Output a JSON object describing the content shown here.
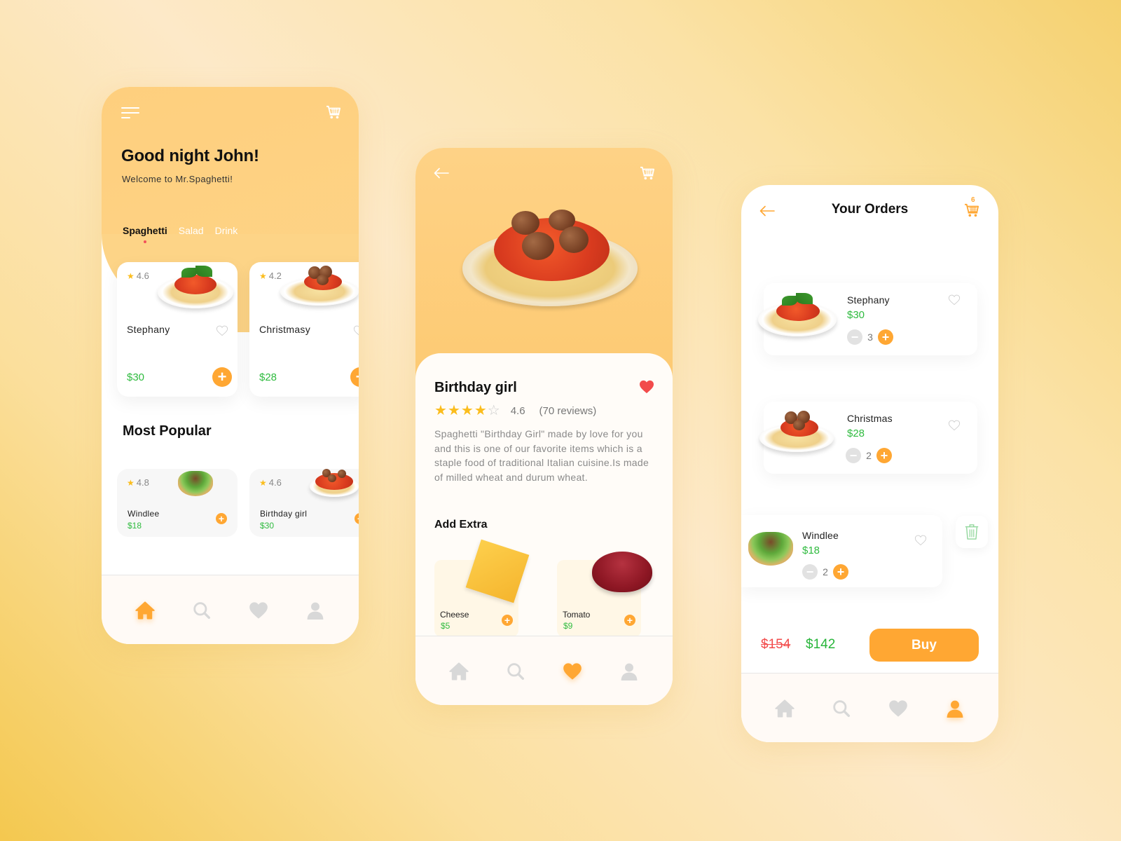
{
  "colors": {
    "accent": "#ffa733",
    "header": "#fdd487",
    "price_green": "#2fbb3f",
    "strike_red": "#f24b4b",
    "heart_red": "#f24b4b",
    "star": "#fbbd1d",
    "nav_inactive": "#d8d8d8"
  },
  "home": {
    "greeting": "Good night John!",
    "welcome": "Welcome to Mr.Spaghetti!",
    "icons": {
      "menu": "menu-icon",
      "cart": "cart-icon"
    },
    "categories": [
      {
        "label": "Spaghetti",
        "active": true
      },
      {
        "label": "Salad",
        "active": false
      },
      {
        "label": "Drink",
        "active": false
      }
    ],
    "featured": [
      {
        "name": "Stephany",
        "rating": "4.6",
        "price": "$30"
      },
      {
        "name": "Christmasy",
        "rating": "4.2",
        "price": "$28"
      }
    ],
    "popular_title": "Most Popular",
    "popular": [
      {
        "name": "Windlee",
        "rating": "4.8",
        "price": "$18"
      },
      {
        "name": "Birthday girl",
        "rating": "4.6",
        "price": "$30"
      }
    ],
    "nav": {
      "active": "home",
      "items": [
        "home",
        "search",
        "favorites",
        "profile"
      ]
    }
  },
  "detail": {
    "icons": {
      "back": "back-arrow-icon",
      "cart": "cart-icon"
    },
    "title": "Birthday girl",
    "favorited": true,
    "stars_filled": 4,
    "stars_total": 5,
    "rating": "4.6",
    "reviews": "(70 reviews)",
    "description": "Spaghetti \"Birthday Girl\" made by love for you and this is one of our favorite items which is a staple food of traditional Italian cuisine.Is made of milled wheat and durum wheat.",
    "extras_title": "Add Extra",
    "extras": [
      {
        "name": "Cheese",
        "price": "$5"
      },
      {
        "name": "Tomato",
        "price": "$9"
      }
    ],
    "nav": {
      "active": "favorites",
      "items": [
        "home",
        "search",
        "favorites",
        "profile"
      ]
    }
  },
  "orders": {
    "title": "Your Orders",
    "cart_count": "6",
    "items": [
      {
        "name": "Stephany",
        "price": "$30",
        "qty": "3"
      },
      {
        "name": "Christmas",
        "price": "$28",
        "qty": "2"
      },
      {
        "name": "Windlee",
        "price": "$18",
        "qty": "2"
      }
    ],
    "old_total": "$154",
    "new_total": "$142",
    "buy_label": "Buy",
    "nav": {
      "active": "profile",
      "items": [
        "home",
        "search",
        "favorites",
        "profile"
      ]
    }
  }
}
